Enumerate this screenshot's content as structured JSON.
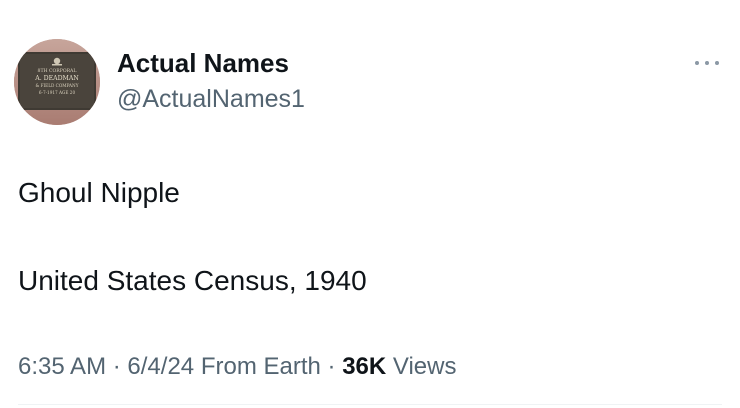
{
  "author": {
    "display_name": "Actual Names",
    "handle": "@ActualNames1",
    "avatar_plaque_lines": [
      "8TH CORPORAL",
      "A. DEADMAN",
      "& FIELD COMPANY",
      "6-7-1917 AGE 20"
    ]
  },
  "more_icon": "more-horizontal-icon",
  "tweet": {
    "line1": "Ghoul Nipple",
    "line2": "United States Census, 1940"
  },
  "meta": {
    "time": "6:35 AM",
    "sep1": "·",
    "date": "6/4/24",
    "source": "From Earth",
    "sep2": "·",
    "views_count": "36K",
    "views_label": "Views"
  },
  "colors": {
    "text_primary": "#0f1419",
    "text_secondary": "#536471",
    "more_dots": "#8b98a5",
    "divider": "#eff3f4"
  }
}
